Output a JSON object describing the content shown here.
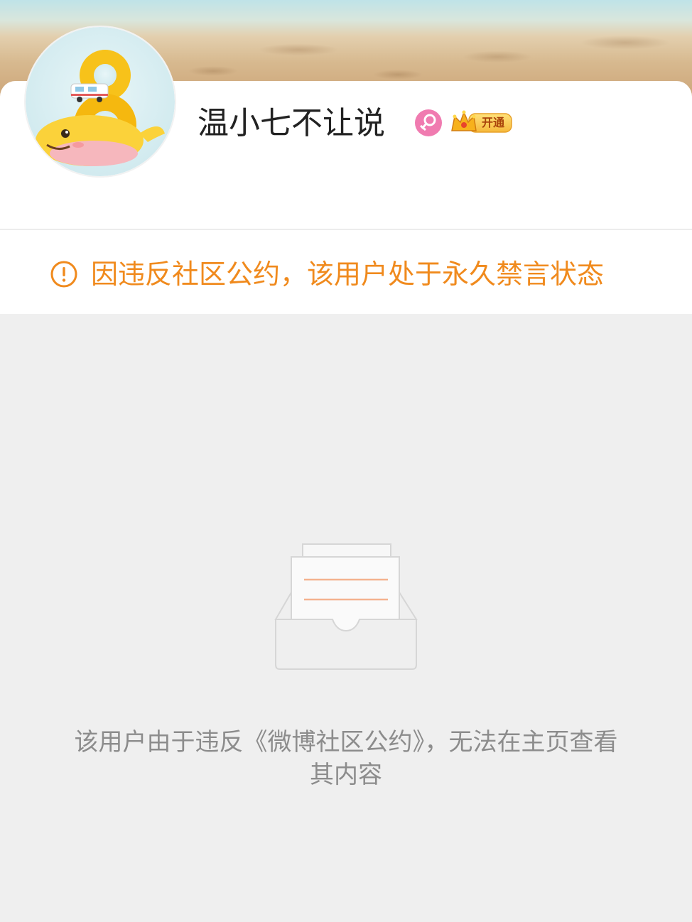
{
  "profile": {
    "username": "温小七不让说",
    "gender_icon": "female-icon",
    "vip_icon": "crown-icon",
    "vip_label": "开通"
  },
  "notice": {
    "icon": "exclamation-circle-icon",
    "text": "因违反社区公约，该用户处于永久禁言状态"
  },
  "empty_state": {
    "illustration": "empty-inbox-icon",
    "message": "该用户由于违反《微博社区公约》，无法在主页查看其内容"
  },
  "colors": {
    "notice_orange": "#f08a1d",
    "muted_text": "#8c8c8c",
    "gender_pink": "#f07bb0",
    "background_gray": "#efefef"
  }
}
